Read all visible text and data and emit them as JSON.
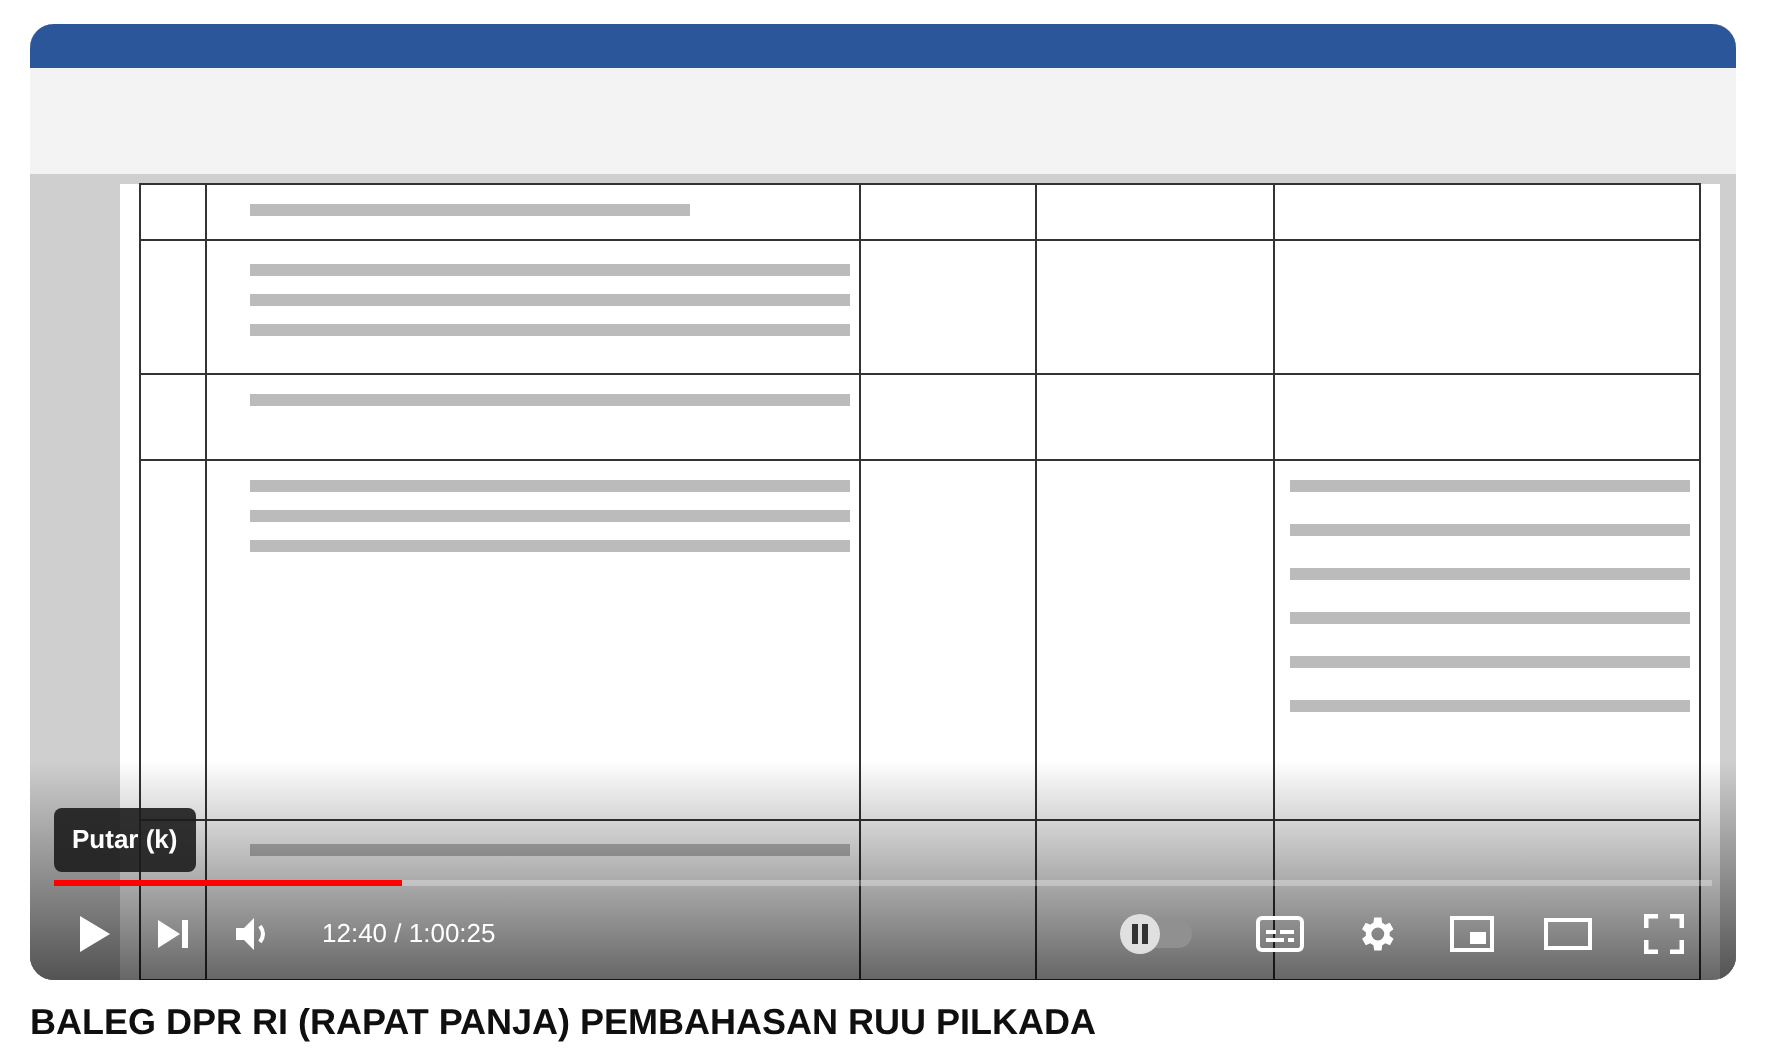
{
  "video": {
    "tooltip": "Putar (k)",
    "progress": {
      "level": 0.21
    },
    "time": "12:40 / 1:00:25",
    "autoplay": {
      "on": false
    }
  },
  "title": "BALEG DPR RI (RAPAT PANJA) PEMBAHASAN RUU PILKADA"
}
